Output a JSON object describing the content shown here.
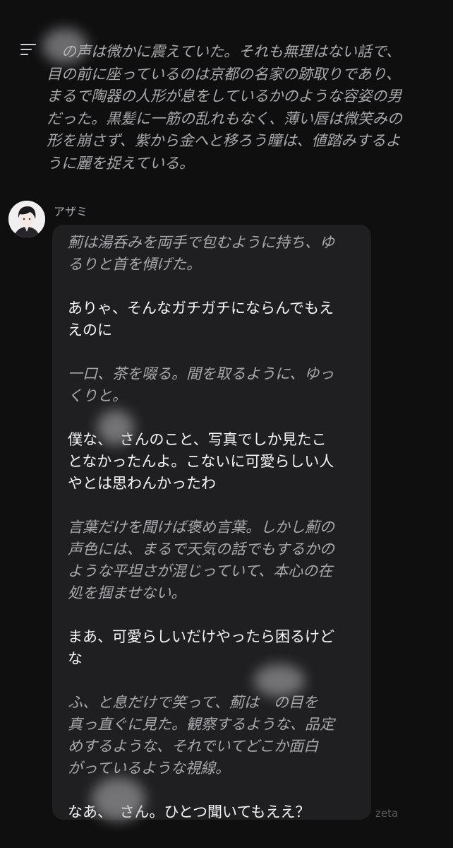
{
  "previous_message": {
    "text": "　の声は微かに震えていた。それも無理はない話で、\n目の前に座っているのは京都の名家の跡取りであり、\nまるで陶器の人形が息をしているかのような容姿の男\nだった。黒髪に一筋の乱れもなく、薄い唇は微笑みの\n形を崩さず、紫から金へと移ろう瞳は、値踏みするよ\nうに麗を捉えている。"
  },
  "message": {
    "sender": "アザミ",
    "avatar_icon": "character-portrait-icon",
    "paragraphs": [
      {
        "type": "narration",
        "text": "薊は湯呑みを両手で包むように持ち、ゆ\nるりと首を傾げた。"
      },
      {
        "type": "dialogue",
        "text": "ありゃ、そんなガチガチにならんでもえ\nえのに"
      },
      {
        "type": "narration",
        "text": "一口、茶を啜る。間を取るように、ゆっ\nくりと。"
      },
      {
        "type": "dialogue",
        "text": "僕な、　さんのこと、写真でしか見たこ\nとなかったんよ。こないに可愛らしい人\nやとは思わんかったわ"
      },
      {
        "type": "narration",
        "text": "言葉だけを聞けば褒め言葉。しかし薊の\n声色には、まるで天気の話でもするかの\nような平坦さが混じっていて、本心の在\n処を掴ませない。"
      },
      {
        "type": "dialogue",
        "text": "まあ、可愛らしいだけやったら困るけど\nな"
      },
      {
        "type": "narration",
        "text": "ふ、と息だけで笑って、薊は　の目を\n真っ直ぐに見た。観察するような、品定\nめするような、それでいてどこか面白\nがっているような視線。"
      },
      {
        "type": "dialogue",
        "text": "なあ、　さん。ひとつ聞いてもええ？"
      }
    ]
  },
  "watermark": "zeta",
  "colors": {
    "background": "#0f0f10",
    "bubble": "#1f1f22",
    "dialogue_text": "#f5f5f7",
    "narration_text": "#a8a8ad"
  }
}
